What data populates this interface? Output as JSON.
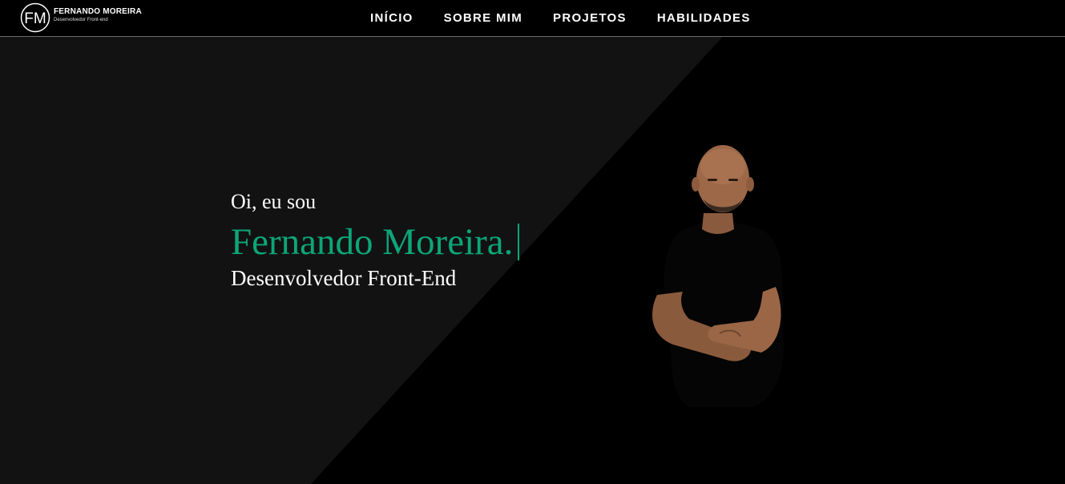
{
  "brand": {
    "monogram": "FM",
    "name": "FERNANDO MOREIRA",
    "tagline": "Desenvolvedor Front-end"
  },
  "nav": {
    "items": [
      {
        "label": "INÍCIO"
      },
      {
        "label": "SOBRE MIM"
      },
      {
        "label": "PROJETOS"
      },
      {
        "label": "HABILIDADES"
      }
    ]
  },
  "hero": {
    "greeting": "Oi, eu sou",
    "name": "Fernando Moreira.",
    "role": "Desenvolvedor Front-End"
  },
  "colors": {
    "accent": "#0ca678",
    "background": "#000000",
    "panel": "#121212",
    "text": "#ffffff"
  }
}
